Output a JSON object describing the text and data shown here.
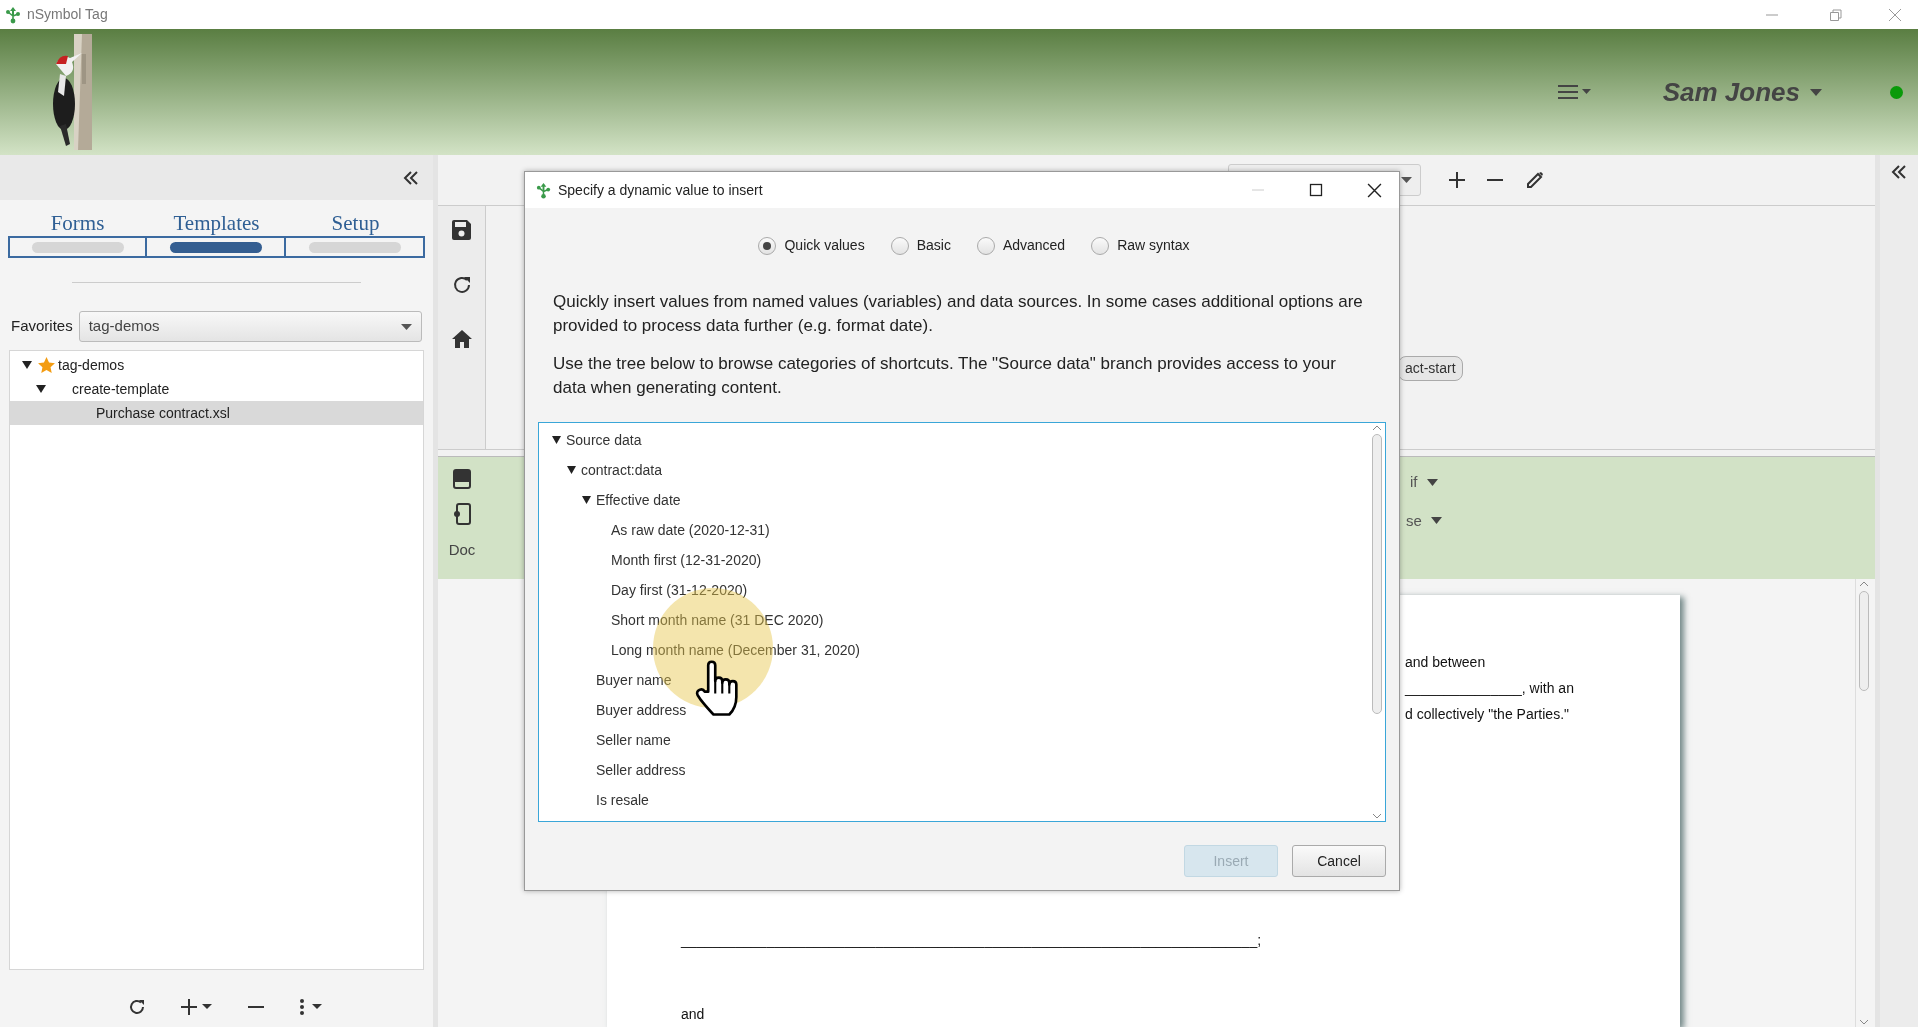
{
  "window": {
    "title": "nSymbol Tag"
  },
  "header": {
    "user": "Sam Jones",
    "online": true
  },
  "left_panel": {
    "tabs": [
      {
        "label": "Forms",
        "selected": false
      },
      {
        "label": "Templates",
        "selected": true
      },
      {
        "label": "Setup",
        "selected": false
      }
    ],
    "favorites": {
      "label": "Favorites",
      "value": "tag-demos"
    },
    "tree": [
      {
        "label": "tag-demos",
        "starred": true,
        "expanded": true,
        "selected": false,
        "children": [
          {
            "label": "create-template",
            "starred": false,
            "expanded": true,
            "selected": false,
            "children": [
              {
                "label": "Purchase contract.xsl",
                "starred": false,
                "selected": true
              }
            ]
          }
        ]
      }
    ]
  },
  "editor": {
    "tag_chip": "act-start",
    "side_label": "Doc",
    "controls": [
      "if",
      "se"
    ],
    "document_lines": [
      {
        "kind": "right",
        "text": "and between"
      },
      {
        "kind": "right",
        "text": "_______________, with an"
      },
      {
        "kind": "right",
        "text": "d collectively \"the Parties.\""
      },
      {
        "kind": "blank",
        "text": "__________________________________________________________________________;"
      },
      {
        "kind": "plain",
        "text": "and"
      }
    ]
  },
  "dialog": {
    "title": "Specify a dynamic value to insert",
    "modes": [
      {
        "label": "Quick values",
        "selected": true
      },
      {
        "label": "Basic",
        "selected": false
      },
      {
        "label": "Advanced",
        "selected": false
      },
      {
        "label": "Raw syntax",
        "selected": false
      }
    ],
    "paragraphs": [
      "Quickly insert values from named values (variables) and data sources. In some cases additional options are provided to process data further (e.g. format date).",
      "Use the tree below to browse categories of shortcuts. The \"Source data\" branch provides access to your data when generating content."
    ],
    "tree": [
      {
        "label": "Source data",
        "expanded": true,
        "children": [
          {
            "label": "contract:data",
            "expanded": true,
            "children": [
              {
                "label": "Effective date",
                "expanded": true,
                "children": [
                  {
                    "label": "As raw date (2020-12-31)"
                  },
                  {
                    "label": "Month first (12-31-2020)"
                  },
                  {
                    "label": "Day first (31-12-2020)"
                  },
                  {
                    "label": "Short month name (31 DEC 2020)"
                  },
                  {
                    "label": "Long month name (December 31, 2020)"
                  }
                ]
              },
              {
                "label": "Buyer name"
              },
              {
                "label": "Buyer address"
              },
              {
                "label": "Seller name"
              },
              {
                "label": "Seller address"
              },
              {
                "label": "Is resale"
              }
            ]
          }
        ]
      }
    ],
    "buttons": [
      {
        "label": "Insert",
        "disabled": true
      },
      {
        "label": "Cancel",
        "disabled": false
      }
    ]
  }
}
